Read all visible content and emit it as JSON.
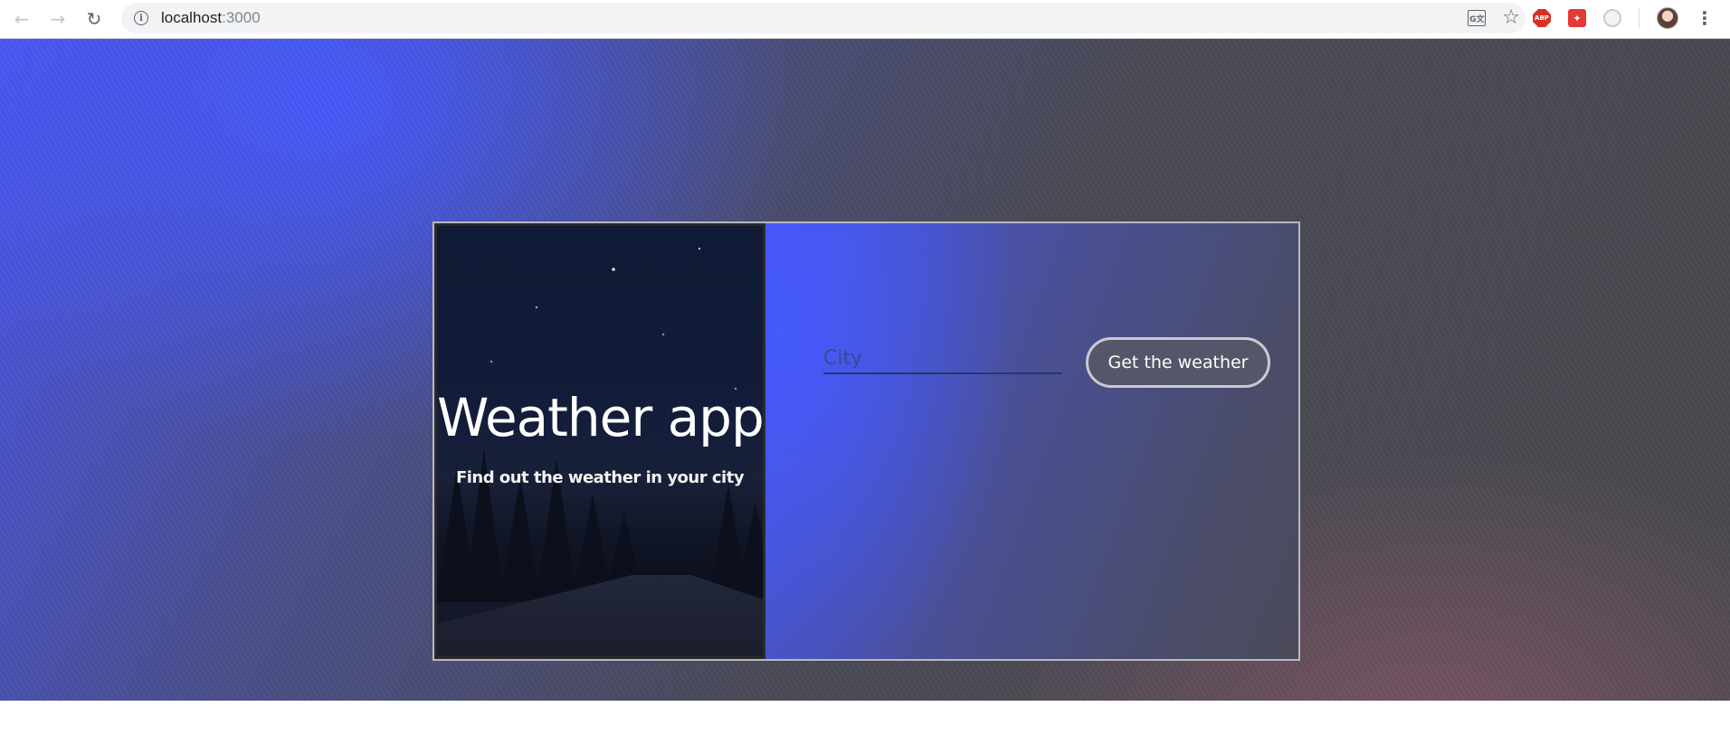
{
  "browser": {
    "url_host": "localhost",
    "url_port": ":3000",
    "back_icon": "←",
    "forward_icon": "→",
    "reload_icon": "↻",
    "info_icon": "i",
    "translate_icon": "G文",
    "bookmark_icon": "☆",
    "extensions": [
      "adblock-icon",
      "extension-red-icon",
      "extension-gray-icon"
    ],
    "menu_icon": "⋮"
  },
  "app": {
    "title": "Weather app",
    "subtitle": "Find out the weather in your city",
    "city_placeholder": "City",
    "city_value": "",
    "submit_label": "Get the weather"
  },
  "colors": {
    "accent_blue": "#4756e8",
    "background_dark": "#4a494f",
    "input_underline": "#1e3a6e",
    "button_border": "#c9c9d0"
  }
}
